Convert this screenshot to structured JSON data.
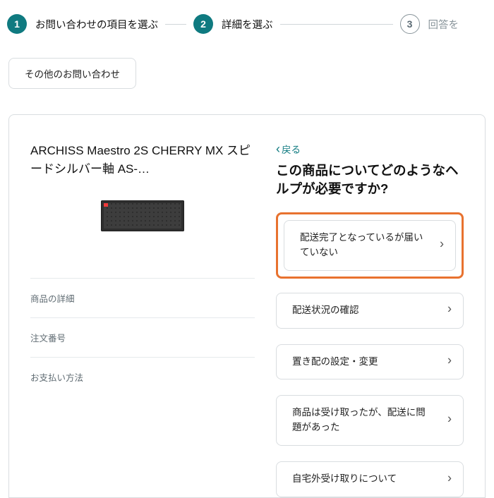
{
  "steps": {
    "s1": {
      "num": "1",
      "label": "お問い合わせの項目を選ぶ"
    },
    "s2": {
      "num": "2",
      "label": "詳細を選ぶ"
    },
    "s3": {
      "num": "3",
      "label": "回答を"
    }
  },
  "other_inquiry_label": "その他のお問い合わせ",
  "product": {
    "title": "ARCHISS Maestro 2S CHERRY MX スピードシルバー軸 AS-…",
    "detail_label": "商品の詳細",
    "order_label": "注文番号",
    "payment_label": "お支払い方法"
  },
  "help": {
    "back_label": "戻る",
    "title": "この商品についてどのようなヘルプが必要ですか?",
    "options": {
      "o1": "配送完了となっているが届いていない",
      "o2": "配送状況の確認",
      "o3": "置き配の設定・変更",
      "o4": "商品は受け取ったが、配送に問題があった",
      "o5": "自宅外受け取りについて"
    }
  }
}
